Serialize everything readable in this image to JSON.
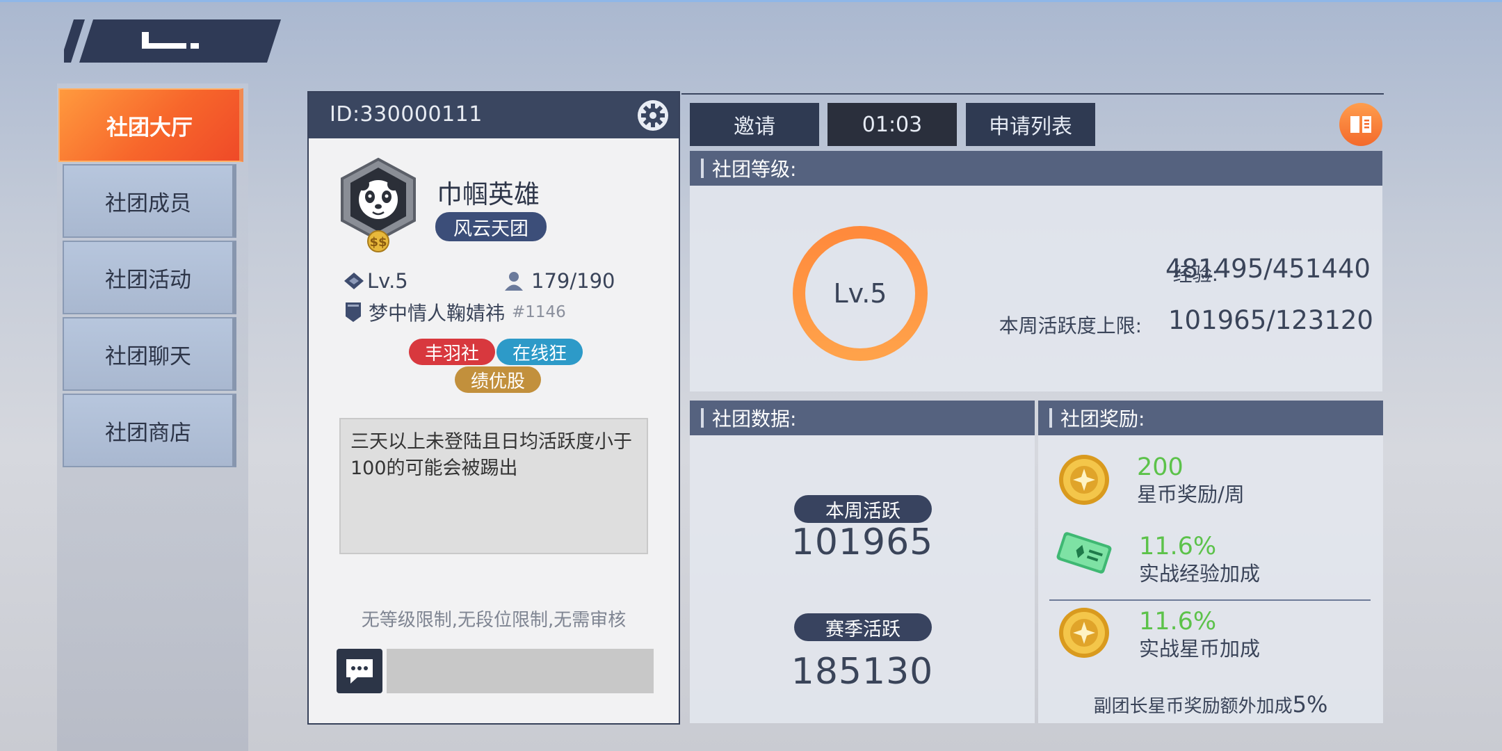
{
  "back": {
    "icon": "back-arrow-icon"
  },
  "sidebar": {
    "items": [
      {
        "label": "社团大厅",
        "active": true
      },
      {
        "label": "社团成员",
        "active": false
      },
      {
        "label": "社团活动",
        "active": false
      },
      {
        "label": "社团聊天",
        "active": false
      },
      {
        "label": "社团商店",
        "active": false
      }
    ]
  },
  "profile": {
    "id_text": "ID:330000111",
    "name": "巾帼英雄",
    "badge": "风云天团",
    "level": "Lv.5",
    "members": "179/190",
    "leader_name": "梦中情人鞠婧祎",
    "leader_tag": "#1146",
    "tags": [
      "丰羽社",
      "在线狂",
      "绩优股"
    ],
    "notice": "三天以上未登陆且日均活跃度小于100的可能会被踢出",
    "restrictions": "无等级限制,无段位限制,无需审核"
  },
  "actions": {
    "invite": "邀请",
    "timer": "01:03",
    "apply_list": "申请列表"
  },
  "level_panel": {
    "title": "社团等级:",
    "ring_label": "Lv.5",
    "exp_label": "经验:",
    "exp_value": "481495/451440",
    "weekly_cap_label": "本周活跃度上限:",
    "weekly_cap_value": "101965/123120"
  },
  "data_panel": {
    "title": "社团数据:",
    "weekly_label": "本周活跃",
    "weekly_value": "101965",
    "season_label": "赛季活跃",
    "season_value": "185130"
  },
  "reward_panel": {
    "title": "社团奖励:",
    "rewards": [
      {
        "value": "200",
        "desc": "星币奖励/周",
        "icon": "star-coin-icon"
      },
      {
        "value": "11.6%",
        "desc": "实战经验加成",
        "icon": "exp-ticket-icon"
      },
      {
        "value": "11.6%",
        "desc": "实战星币加成",
        "icon": "star-coin-icon"
      }
    ],
    "footer_text": "副团长星币奖励额外加成",
    "footer_pct": "5%"
  },
  "colors": {
    "accent": "#f7662b",
    "reward_green": "#5cc24a",
    "panel_header": "#55627f"
  }
}
